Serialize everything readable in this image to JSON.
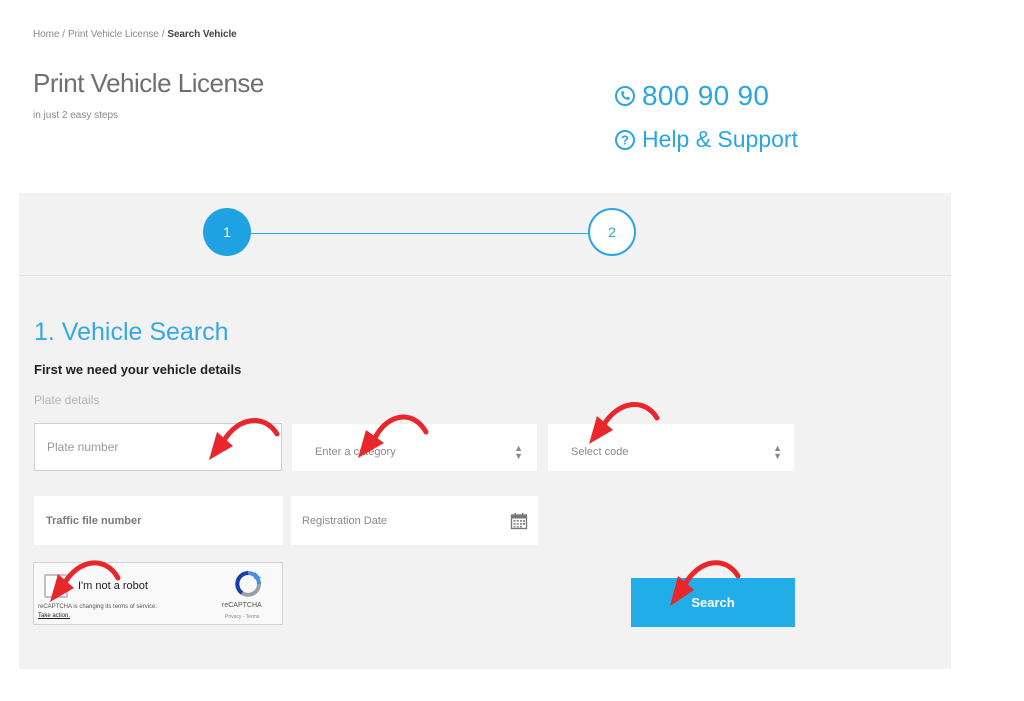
{
  "breadcrumb": {
    "home": "Home",
    "parent": "Print Vehicle License",
    "current": "Search Vehicle"
  },
  "header": {
    "title": "Print Vehicle License",
    "subtitle": "in just 2 easy steps"
  },
  "contact": {
    "phone": "800 90 90",
    "help": "Help & Support"
  },
  "stepper": {
    "steps": [
      "1",
      "2"
    ],
    "current": 1
  },
  "section": {
    "title": "1. Vehicle Search",
    "description": "First we need your vehicle details",
    "group_label": "Plate details"
  },
  "form": {
    "plate_placeholder": "Plate number",
    "category_placeholder": "Enter a category",
    "code_placeholder": "Select code",
    "traffic_placeholder": "Traffic file number",
    "date_placeholder": "Registration Date"
  },
  "captcha": {
    "label": "I'm not a robot",
    "notice": "reCAPTCHA is changing its terms of service.",
    "action": "Take action.",
    "brand": "reCAPTCHA",
    "terms": "Privacy - Terms"
  },
  "actions": {
    "search_label": "Search"
  },
  "colors": {
    "accent": "#22ade8",
    "annotation": "#e8262b",
    "panel": "#f2f2f2"
  },
  "icons": [
    "phone-icon",
    "help-icon",
    "updown-arrows-icon",
    "calendar-icon",
    "recaptcha-logo-icon",
    "annotation-arrow-icon"
  ]
}
